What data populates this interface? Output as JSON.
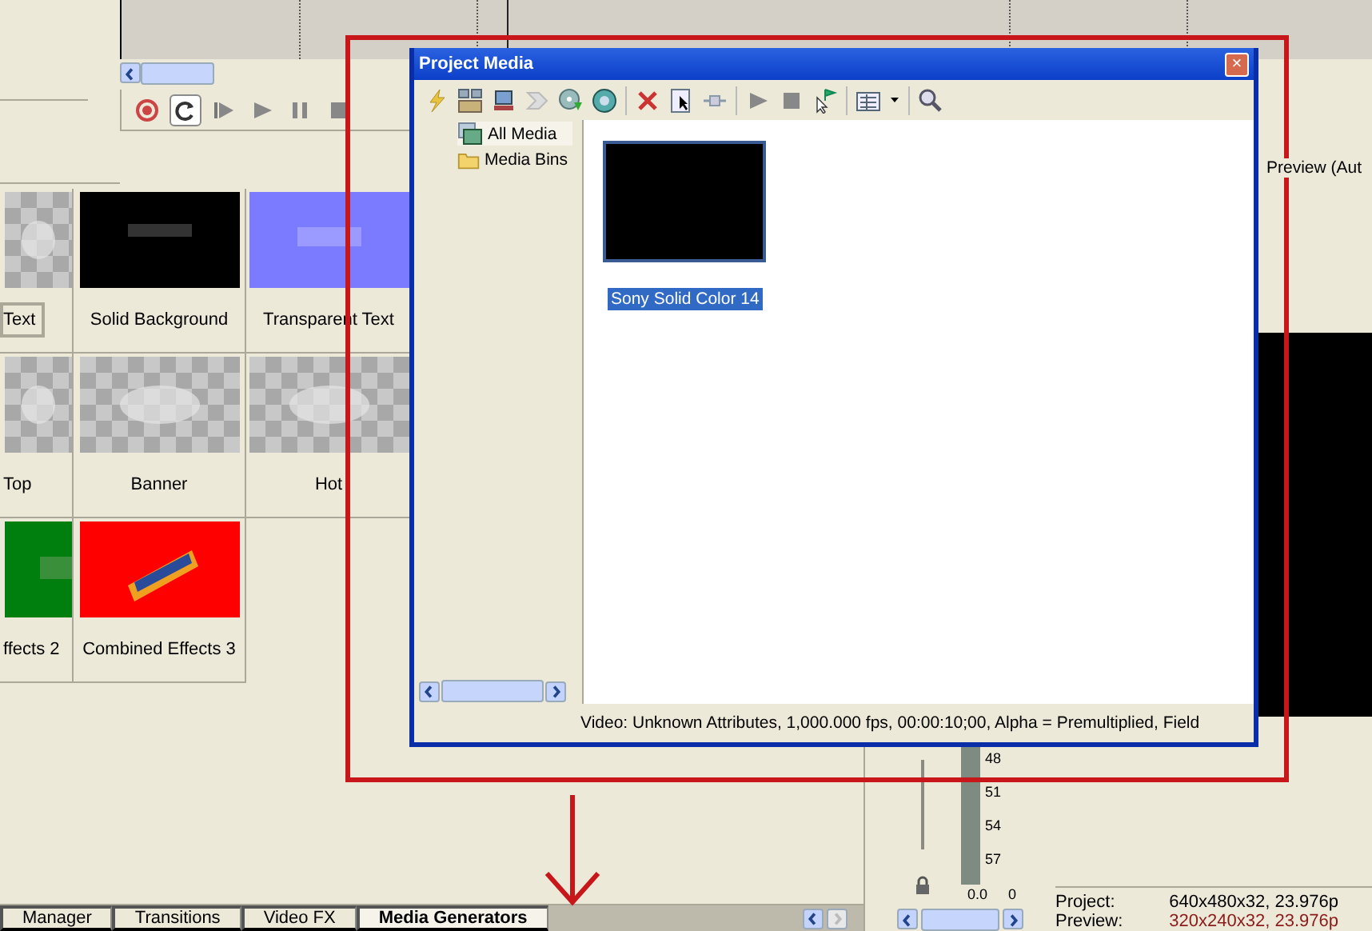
{
  "timeline": {
    "loop_on": true
  },
  "generators": {
    "presets": [
      {
        "label": "Text",
        "kind": "checker",
        "selected": true
      },
      {
        "label": "Solid Background",
        "kind": "black",
        "selected": false
      },
      {
        "label": "Transparent Text",
        "kind": "blue",
        "selected": false
      },
      {
        "label": "Top",
        "kind": "checker",
        "selected": false
      },
      {
        "label": "Banner",
        "kind": "checker",
        "selected": false
      },
      {
        "label": "Hot",
        "kind": "checker",
        "selected": false
      },
      {
        "label": "ffects 2",
        "kind": "green",
        "selected": false
      },
      {
        "label": "Combined Effects 3",
        "kind": "red",
        "selected": false
      }
    ]
  },
  "bottom_tabs": [
    {
      "label": "Manager",
      "selected": false
    },
    {
      "label": "Transitions",
      "selected": false
    },
    {
      "label": "Video FX",
      "selected": false
    },
    {
      "label": "Media Generators",
      "selected": true
    }
  ],
  "meter": {
    "ticks": [
      "48",
      "51",
      "54",
      "57"
    ],
    "readings": [
      "0.0",
      "0"
    ]
  },
  "preview": {
    "label": "Preview (Aut",
    "info": [
      {
        "key": "Project:",
        "value": "640x480x32, 23.976p",
        "kind": "project"
      },
      {
        "key": "Preview:",
        "value": "320x240x32, 23.976p",
        "kind": "preview"
      }
    ]
  },
  "dialog": {
    "title": "Project Media",
    "close": "×",
    "tree": [
      {
        "label": "All Media",
        "kind": "media",
        "selected": true
      },
      {
        "label": "Media Bins",
        "kind": "folder",
        "selected": false
      }
    ],
    "items": [
      {
        "label": "Sony Solid Color 14",
        "selected": true
      }
    ],
    "status": "Video: Unknown Attributes, 1,000.000 fps, 00:00:10;00, Alpha = Premultiplied, Field"
  }
}
